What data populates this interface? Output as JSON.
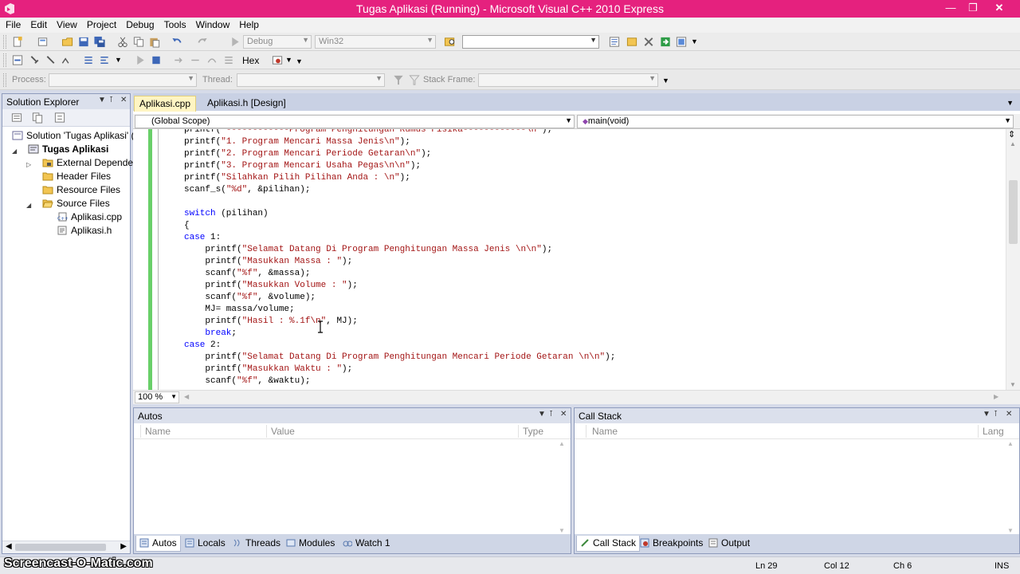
{
  "window": {
    "title": "Tugas Aplikasi (Running) - Microsoft Visual C++ 2010 Express"
  },
  "menu": [
    "File",
    "Edit",
    "View",
    "Project",
    "Debug",
    "Tools",
    "Window",
    "Help"
  ],
  "toolbar": {
    "config": "Debug",
    "platform": "Win32",
    "hex_label": "Hex",
    "process_label": "Process:",
    "thread_label": "Thread:",
    "stackframe_label": "Stack Frame:"
  },
  "solution_explorer": {
    "title": "Solution Explorer",
    "items": [
      {
        "label": "Solution 'Tugas Aplikasi' ("
      },
      {
        "label": "Tugas Aplikasi"
      },
      {
        "label": "External Dependen"
      },
      {
        "label": "Header Files"
      },
      {
        "label": "Resource Files"
      },
      {
        "label": "Source Files"
      },
      {
        "label": "Aplikasi.cpp"
      },
      {
        "label": "Aplikasi.h"
      }
    ]
  },
  "editor": {
    "tabs": [
      {
        "label": "Aplikasi.cpp"
      },
      {
        "label": "Aplikasi.h [Design]"
      }
    ],
    "scope": "(Global Scope)",
    "function": "main(void)",
    "zoom": "100 %",
    "lines": [
      "printf(\"------------Program Penghitungan Rumus Fisika------------\\n\");",
      "printf(\"1. Program Mencari Massa Jenis\\n\");",
      "printf(\"2. Program Mencari Periode Getaran\\n\");",
      "printf(\"3. Program Mencari Usaha Pegas\\n\\n\");",
      "printf(\"Silahkan Pilih Pilihan Anda : \\n\");",
      "scanf_s(\"%d\", &pilihan);",
      "",
      "switch (pilihan)",
      "{",
      "case 1:",
      "    printf(\"Selamat Datang Di Program Penghitungan Massa Jenis \\n\\n\");",
      "    printf(\"Masukkan Massa : \");",
      "    scanf(\"%f\", &massa);",
      "    printf(\"Masukkan Volume : \");",
      "    scanf(\"%f\", &volume);",
      "    MJ= massa/volume;",
      "    printf(\"Hasil : %.1f\\n\", MJ);",
      "    break;",
      "case 2:",
      "    printf(\"Selamat Datang Di Program Penghitungan Mencari Periode Getaran \\n\\n\");",
      "    printf(\"Masukkan Waktu : \");",
      "    scanf(\"%f\", &waktu);"
    ]
  },
  "autos": {
    "title": "Autos",
    "columns": [
      "Name",
      "Value",
      "Type"
    ],
    "tabs": [
      "Autos",
      "Locals",
      "Threads",
      "Modules",
      "Watch 1"
    ]
  },
  "callstack": {
    "title": "Call Stack",
    "columns": [
      "Name",
      "Lang"
    ],
    "tabs": [
      "Call Stack",
      "Breakpoints",
      "Output"
    ]
  },
  "status": {
    "watermark": "Screencast-O-Matic.com",
    "ln": "Ln 29",
    "col": "Col 12",
    "ch": "Ch 6",
    "mode": "INS"
  },
  "colors": {
    "titlebar": "#e5217e",
    "keyword": "#0000ff",
    "string": "#a31515",
    "change_bar": "#69cf69",
    "active_tab": "#fff5c3"
  }
}
